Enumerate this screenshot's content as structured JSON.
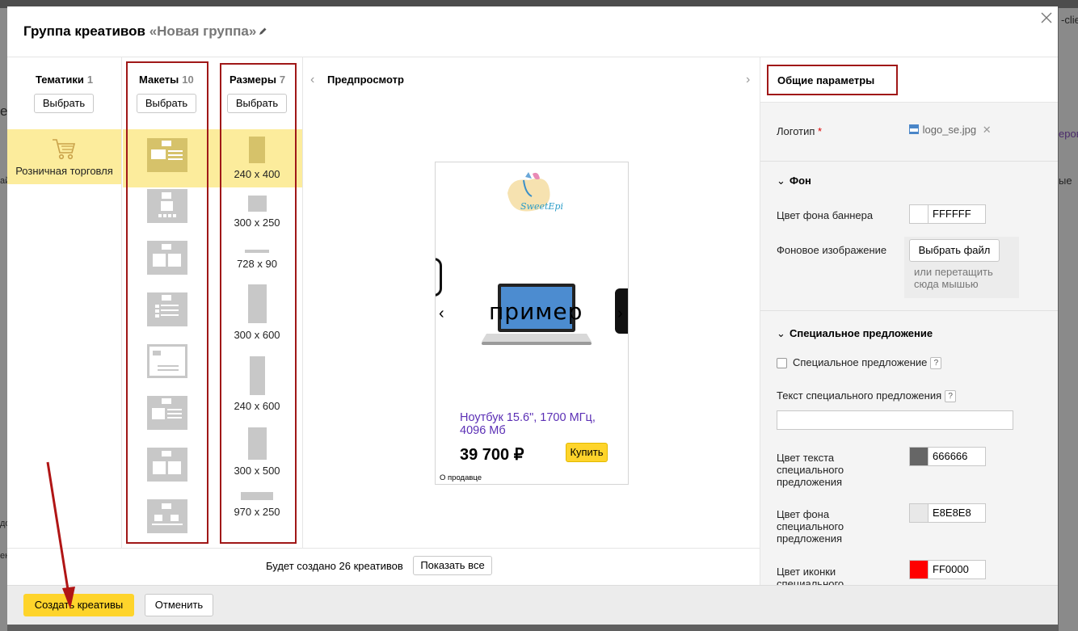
{
  "backdrop": {
    "right_texts": [
      "-clie",
      "еров",
      "ые"
    ],
    "left_texts": [
      "е",
      "ай",
      "до",
      "ен"
    ]
  },
  "modal": {
    "title_prefix": "Группа креативов",
    "group_name": "«Новая группа»",
    "close_icon": "close-icon"
  },
  "columns": {
    "topics": {
      "label": "Тематики",
      "count": "1",
      "button": "Выбрать",
      "item": "Розничная торговля",
      "icon": "cart-icon"
    },
    "layouts": {
      "label": "Макеты",
      "count": "10",
      "button": "Выбрать"
    },
    "sizes": {
      "label": "Размеры",
      "count": "7",
      "button": "Выбрать",
      "items": [
        "240 x 400",
        "300 x 250",
        "728 x 90",
        "300 x 600",
        "240 x 600",
        "300 x 500",
        "970 x 250"
      ]
    },
    "preview": {
      "label": "Предпросмотр",
      "prev_icon": "chevron-left-icon",
      "next_icon": "chevron-right-icon"
    }
  },
  "preview_card": {
    "logo_text": "SweetEpil",
    "watermark": "пример",
    "product_name": "Ноутбук 15.6\", 1700 МГц, 4096 Мб",
    "price": "39 700 ₽",
    "buy_label": "Купить",
    "seller_label": "О продавце",
    "prev_arrow": "‹",
    "next_arrow": "›",
    "colors": {
      "product_name": "#5b2fb5",
      "buy_button": "#fed42b"
    }
  },
  "summary": {
    "text": "Будет создано 26 креативов",
    "show_all": "Показать все"
  },
  "footer": {
    "create_label": "Создать креативы",
    "cancel_label": "Отменить"
  },
  "params": {
    "title": "Общие параметры",
    "logo_label": "Логотип",
    "logo_required": "*",
    "logo_file": "logo_se.jpg",
    "bg_section": "Фон",
    "bg_color_label": "Цвет фона баннера",
    "bg_color_value": "FFFFFF",
    "bg_image_label": "Фоновое изображение",
    "choose_file": "Выбрать файл",
    "drag_hint": "или перетащить сюда мышью",
    "offer_section": "Специальное предложение",
    "offer_checkbox_label": "Специальное предложение",
    "offer_text_label": "Текст специального предложения",
    "help_mark": "?",
    "offer_text_color_label": "Цвет текста специального предложения",
    "offer_text_color_value": "666666",
    "offer_bg_color_label": "Цвет фона специального предложения",
    "offer_bg_color_value": "E8E8E8",
    "offer_icon_color_label": "Цвет иконки специального",
    "offer_icon_color_value": "FF0000",
    "swatches": {
      "bg": "#FFFFFF",
      "text": "#666666",
      "offer_bg": "#E8E8E8",
      "icon": "#FF0000"
    }
  },
  "colors": {
    "accent_yellow": "#fed42b",
    "highlight": "#fcec9c",
    "annotation_red": "#a01818"
  }
}
